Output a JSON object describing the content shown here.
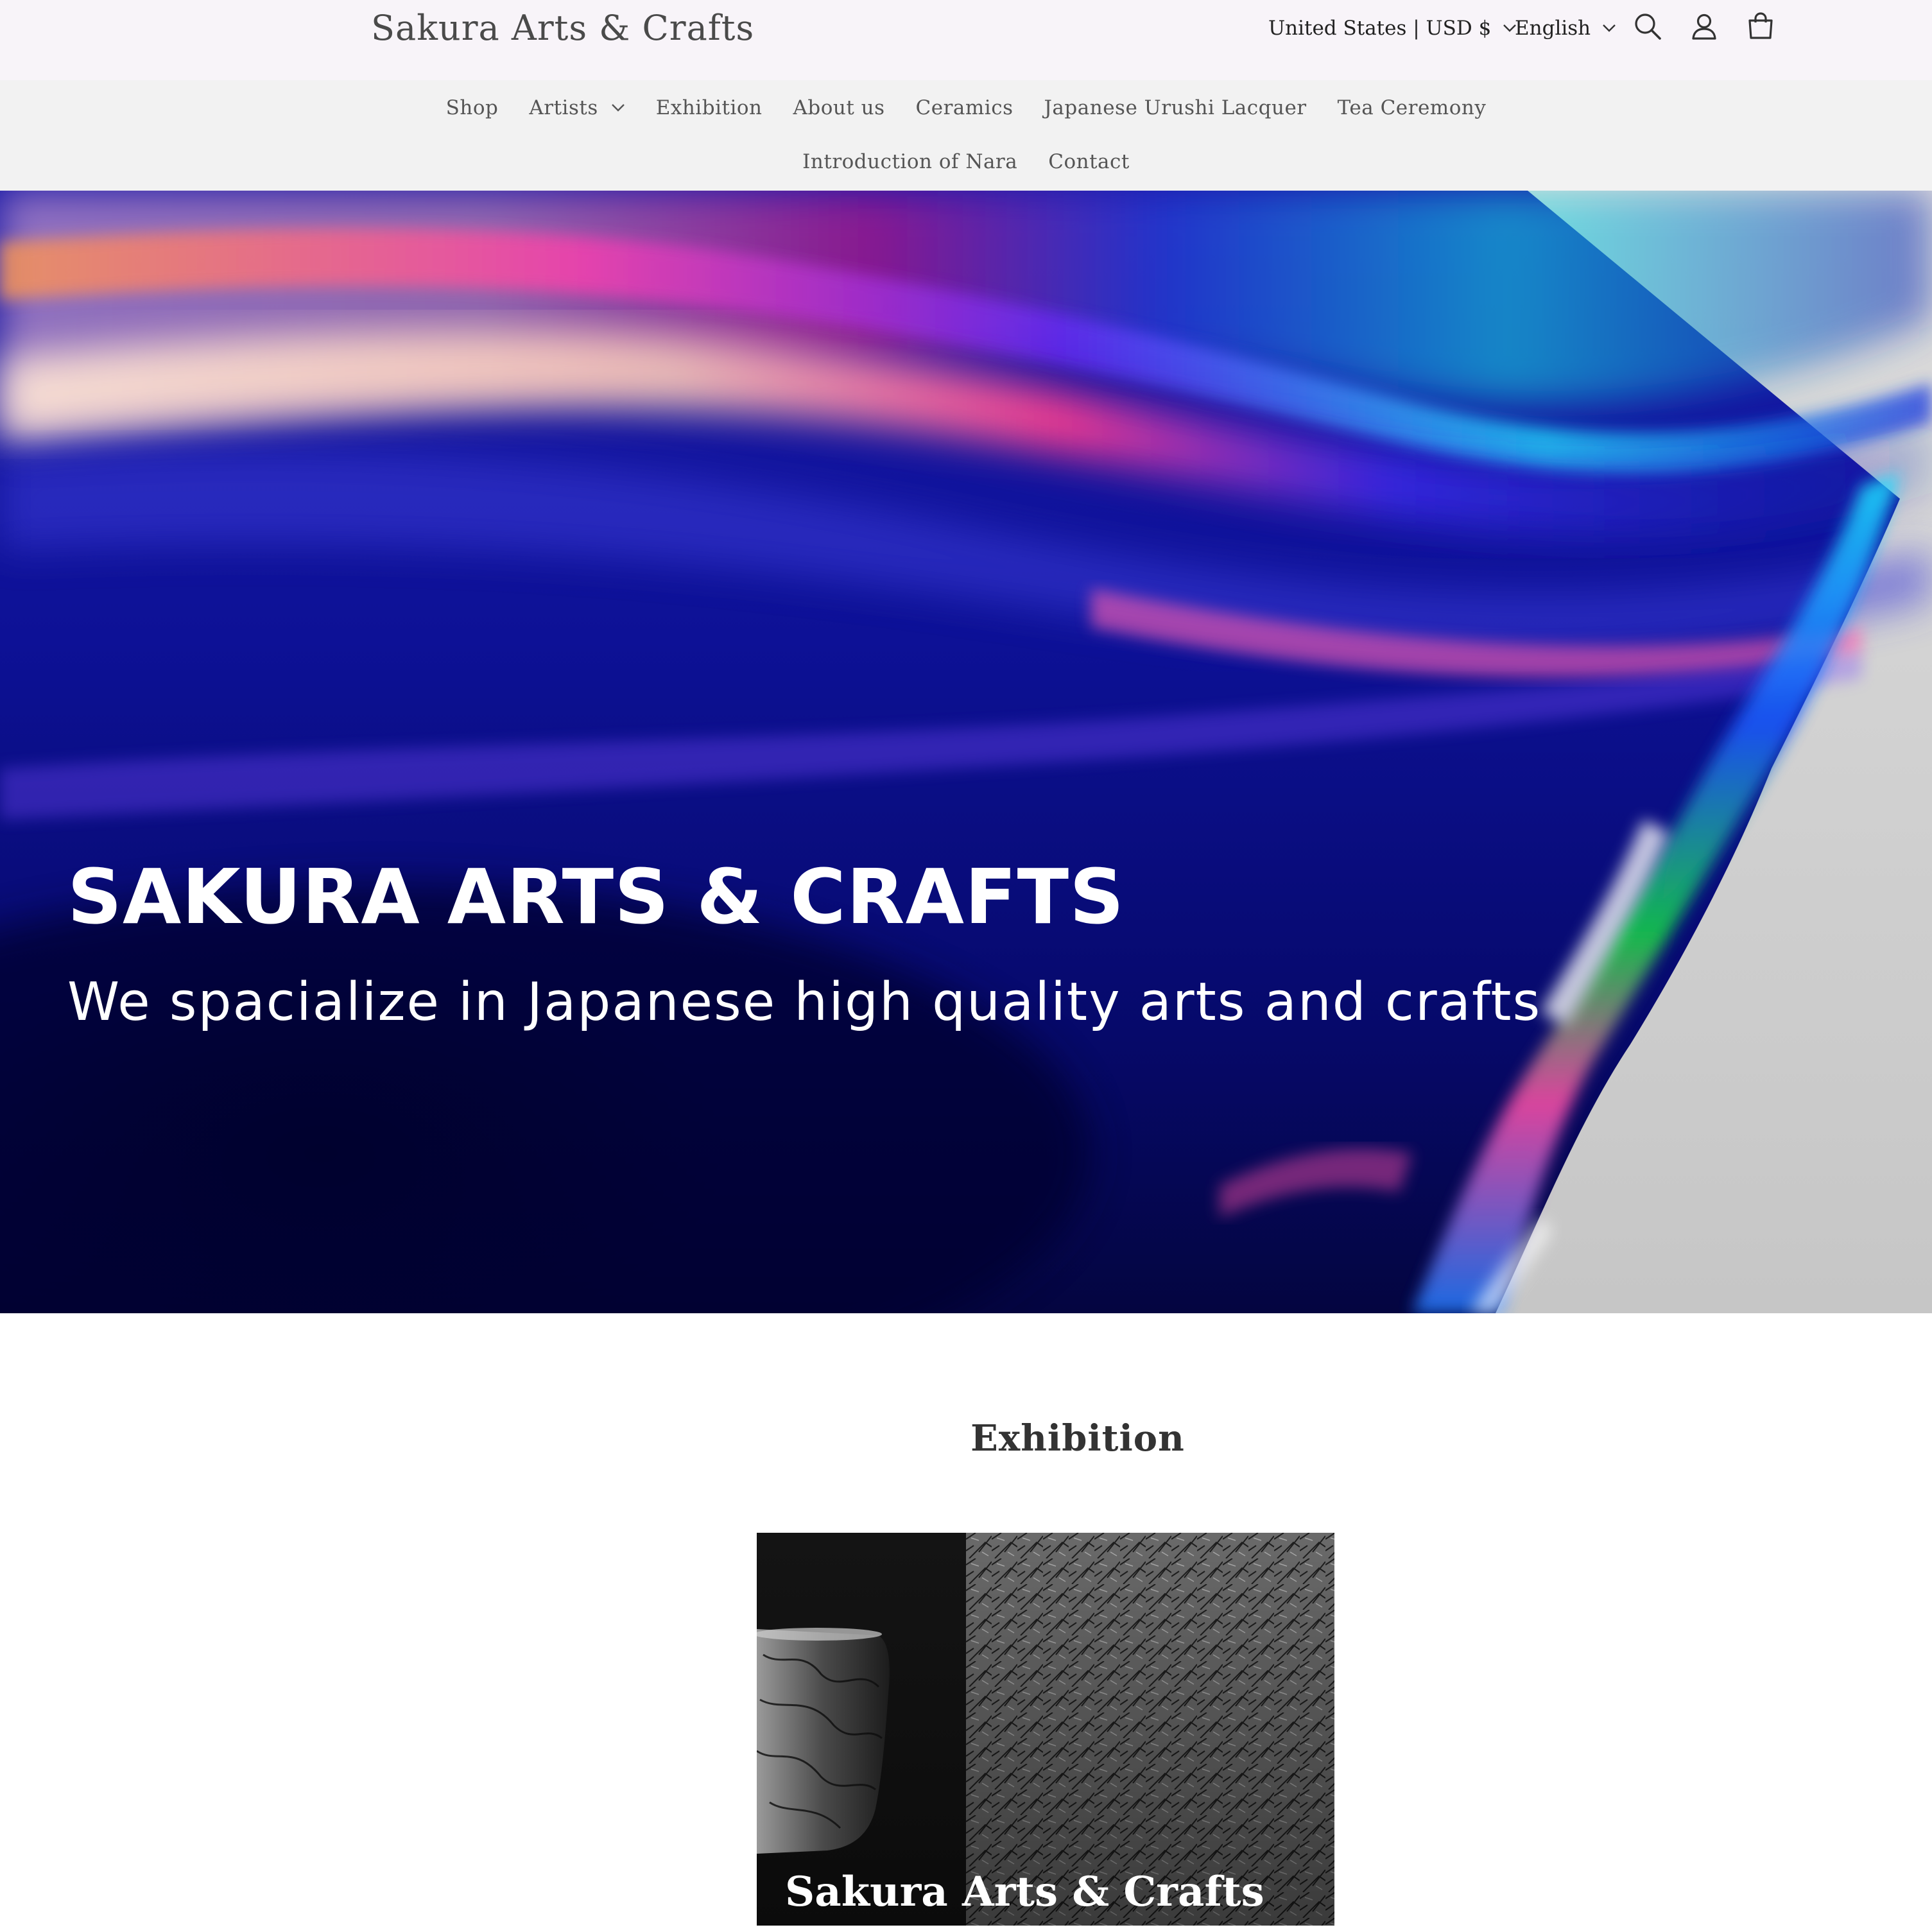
{
  "header": {
    "logo": "Sakura Arts & Crafts",
    "country_selector": "United States | USD $",
    "language_selector": "English",
    "icons": [
      "search-icon",
      "account-icon",
      "cart-icon"
    ]
  },
  "nav": {
    "row1": [
      {
        "label": "Shop"
      },
      {
        "label": "Artists",
        "has_dropdown": true
      },
      {
        "label": "Exhibition"
      },
      {
        "label": "About us"
      },
      {
        "label": "Ceramics"
      },
      {
        "label": "Japanese Urushi Lacquer"
      },
      {
        "label": "Tea Ceremony"
      }
    ],
    "row2": [
      {
        "label": "Introduction of Nara"
      },
      {
        "label": "Contact"
      }
    ]
  },
  "hero": {
    "title": "SAKURA ARTS & CRAFTS",
    "subtitle": "We spacialize in Japanese high quality arts and crafts"
  },
  "exhibition": {
    "heading": "Exhibition",
    "card_caption": "Sakura Arts & Crafts"
  },
  "colors": {
    "header_bg": "#f8f4f9",
    "nav_bg": "#f2f2f2",
    "hero_blue": "#0d1196",
    "text": "#333333"
  }
}
